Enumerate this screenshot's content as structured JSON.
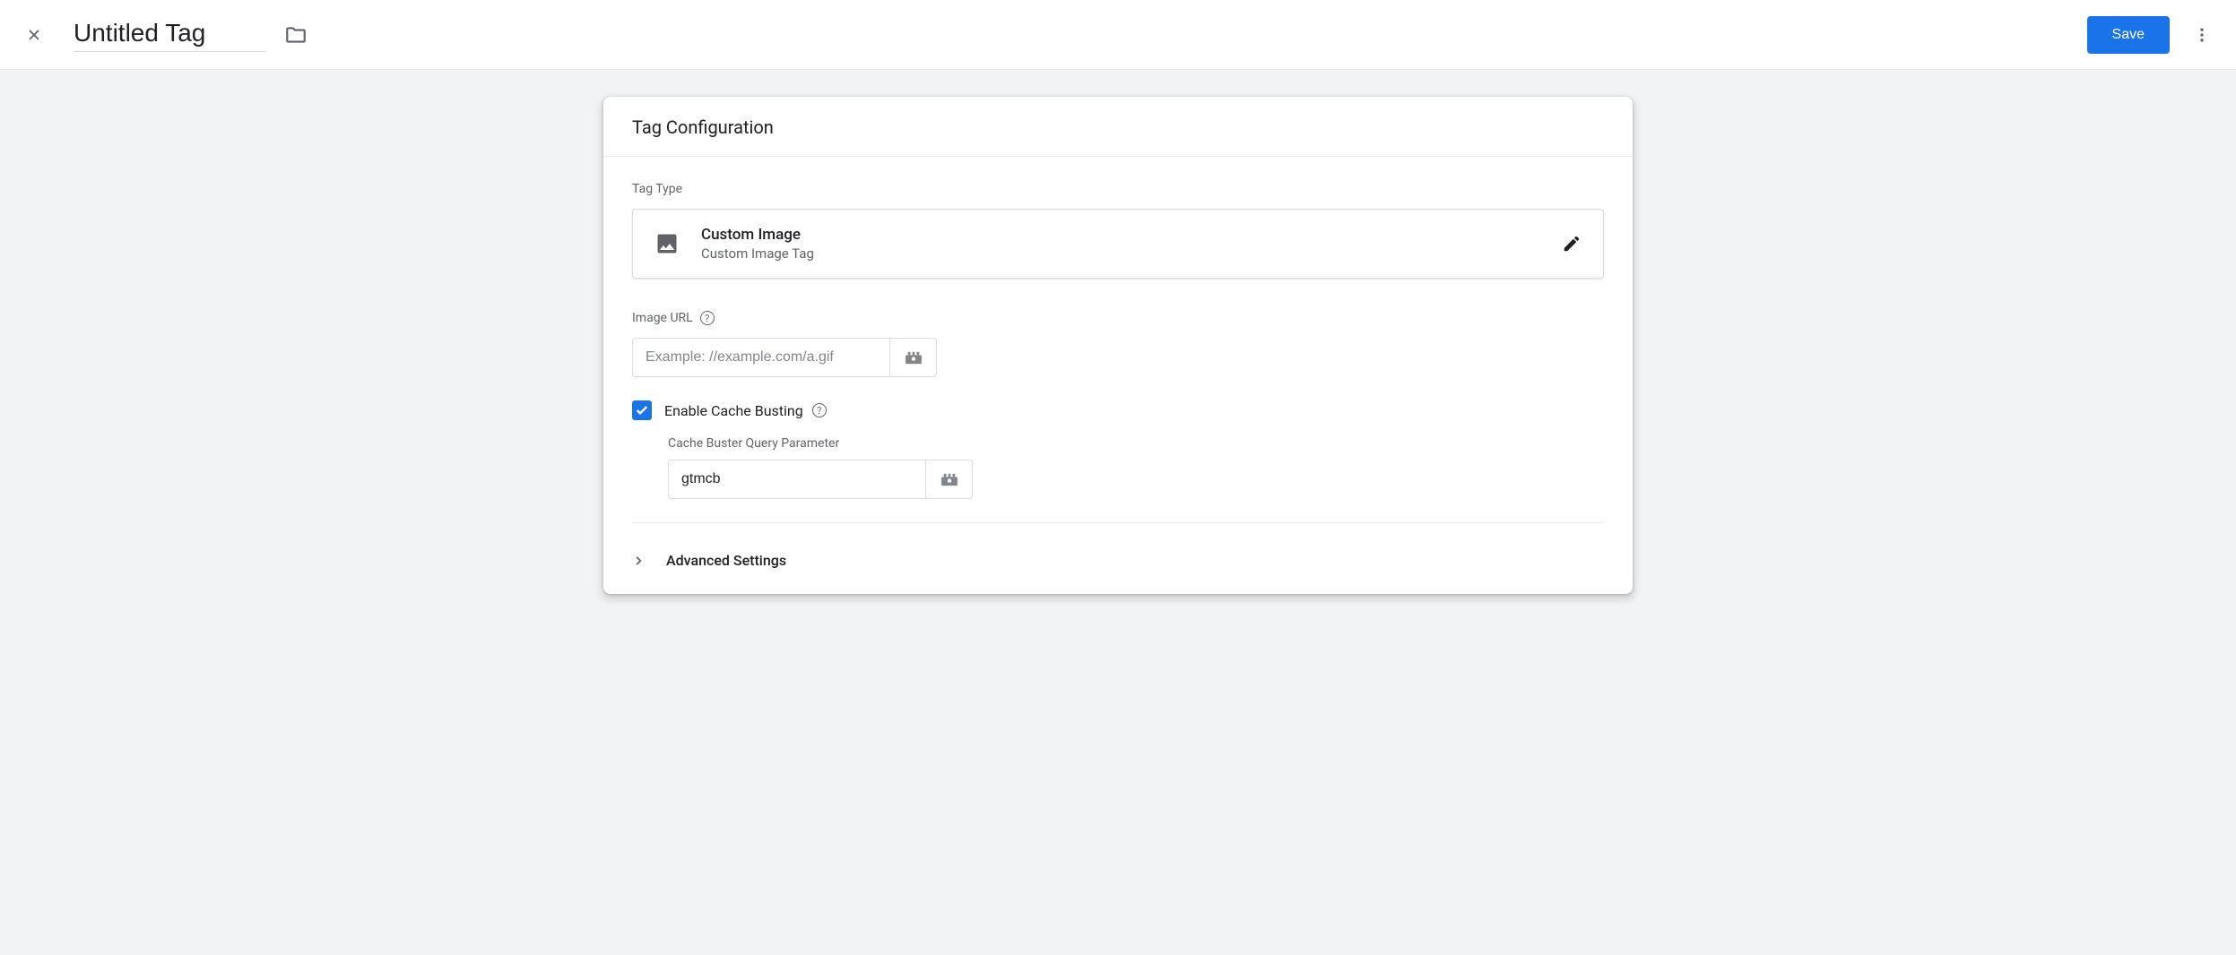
{
  "header": {
    "title_value": "Untitled Tag",
    "save_label": "Save"
  },
  "card": {
    "title": "Tag Configuration",
    "tag_type_label": "Tag Type",
    "tag_type": {
      "name": "Custom Image",
      "subtitle": "Custom Image Tag"
    },
    "image_url": {
      "label": "Image URL",
      "placeholder": "Example: //example.com/a.gif",
      "value": ""
    },
    "cache_busting": {
      "checked": true,
      "label": "Enable Cache Busting",
      "param_label": "Cache Buster Query Parameter",
      "param_value": "gtmcb"
    },
    "advanced_label": "Advanced Settings"
  }
}
